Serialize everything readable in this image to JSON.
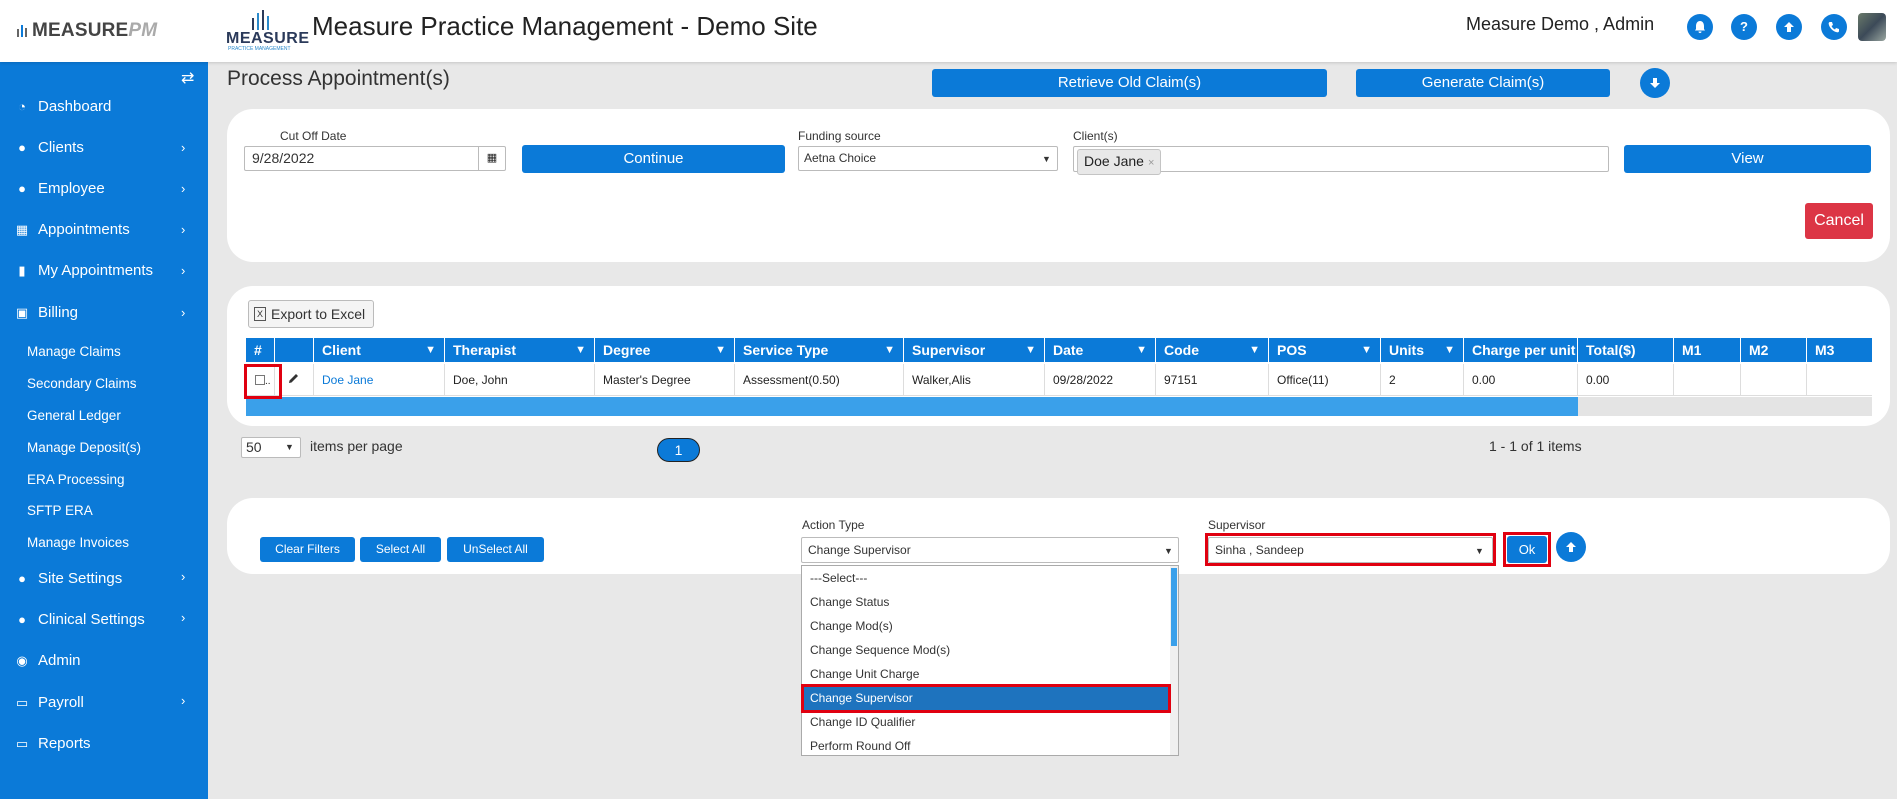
{
  "header": {
    "brand_main": "MEASURE",
    "brand_pm": "PM",
    "logo_main": "MEASURE",
    "logo_sub": "PRACTICE MANAGEMENT",
    "title": "Measure Practice Management - Demo Site",
    "user": "Measure Demo , Admin",
    "icons": [
      "bell-icon",
      "help-icon",
      "upload-icon",
      "phone-icon"
    ]
  },
  "sidebar": {
    "items": [
      {
        "label": "Dashboard",
        "icon": "dashboard-icon"
      },
      {
        "label": "Clients",
        "icon": "user-icon"
      },
      {
        "label": "Employee",
        "icon": "users-icon"
      },
      {
        "label": "Appointments",
        "icon": "calendar-icon"
      },
      {
        "label": "My Appointments",
        "icon": "book-icon"
      },
      {
        "label": "Billing",
        "icon": "money-icon"
      }
    ],
    "billing_sub": [
      "Manage Claims",
      "Secondary Claims",
      "General Ledger",
      "Manage Deposit(s)",
      "ERA Processing",
      "SFTP ERA",
      "Manage Invoices"
    ],
    "items_bottom": [
      {
        "label": "Site Settings",
        "icon": "user-icon"
      },
      {
        "label": "Clinical Settings",
        "icon": "user-icon"
      },
      {
        "label": "Admin",
        "icon": "user-circle-icon"
      },
      {
        "label": "Payroll",
        "icon": "card-icon"
      },
      {
        "label": "Reports",
        "icon": "card-icon"
      }
    ]
  },
  "main": {
    "page_title": "Process Appointment(s)",
    "retrieve_label": "Retrieve Old Claim(s)",
    "generate_label": "Generate Claim(s)",
    "filters": {
      "cutoff_label": "Cut Off Date",
      "cutoff_value": "9/28/2022",
      "continue_label": "Continue",
      "funding_label": "Funding source",
      "funding_value": "Aetna Choice",
      "clients_label": "Client(s)",
      "client_chip": "Doe Jane",
      "view_label": "View",
      "cancel_label": "Cancel"
    },
    "export_label": "Export to Excel",
    "grid": {
      "columns": [
        "#",
        "",
        "Client",
        "Therapist",
        "Degree",
        "Service Type",
        "Supervisor",
        "Date",
        "Code",
        "POS",
        "Units",
        "Charge per unit",
        "Total($)",
        "M1",
        "M2",
        "M3"
      ],
      "rows": [
        [
          "",
          "",
          "Doe Jane",
          "Doe, John",
          "Master's Degree",
          "Assessment(0.50)",
          "Walker,Alis",
          "09/28/2022",
          "97151",
          "Office(11)",
          "2",
          "0.00",
          "0.00",
          "",
          "",
          ""
        ]
      ]
    },
    "pager": {
      "per_page": "50",
      "per_page_label": "items per page",
      "page": "1",
      "summary": "1 - 1 of 1 items"
    },
    "actions": {
      "clear_filters": "Clear Filters",
      "select_all": "Select All",
      "unselect_all": "UnSelect All",
      "action_type_label": "Action Type",
      "action_type_value": "Change Supervisor",
      "supervisor_label": "Supervisor",
      "supervisor_value": "Sinha , Sandeep",
      "ok_label": "Ok",
      "options": [
        "---Select---",
        "Change Status",
        "Change Mod(s)",
        "Change Sequence Mod(s)",
        "Change Unit Charge",
        "Change Supervisor",
        "Change ID Qualifier",
        "Perform Round Off"
      ],
      "selected_option": "Change Supervisor"
    }
  },
  "colors": {
    "primary": "#0b7ad8",
    "danger": "#dc3545",
    "highlight": "#e00010"
  }
}
